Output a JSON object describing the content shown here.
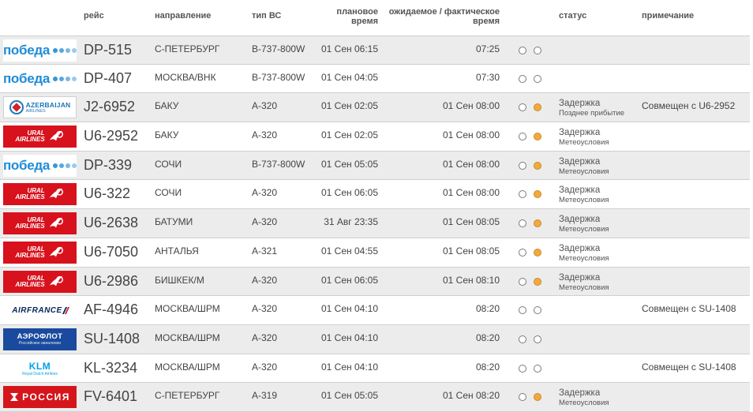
{
  "header": {
    "flight": "рейс",
    "direction": "направление",
    "aircraft_type": "тип ВС",
    "planned_time": "плановое время",
    "expected_time": "ожидаемое / фактическое время",
    "status": "статус",
    "note": "примечание"
  },
  "colors": {
    "indicator_active": "#f3a93c",
    "row_alt": "#ececec",
    "pobeda_blue": "#1f8bd6",
    "ural_red": "#d7121d"
  },
  "logo_text": {
    "pobeda": "победа",
    "ural_1": "URAL",
    "ural_2": "AIRLINES",
    "azal_1": "AZERBAIJAN",
    "azal_2": "AIRLINES",
    "airfrance": "AIRFRANCE",
    "aeroflot_1": "АЭРОФЛОТ",
    "aeroflot_2": "Российские авиалинии",
    "klm_1": "KLM",
    "klm_2": "Royal Dutch Airlines",
    "rossiya": "РОССИЯ"
  },
  "rows": [
    {
      "airline": "pobeda",
      "flight": "DP-515",
      "direction": "С-ПЕТЕРБУРГ",
      "aircraft": "B-737-800W",
      "planned": "01 Сен 06:15",
      "expected": "07:25",
      "ind1": false,
      "ind2": false,
      "status": "",
      "status_sub": "",
      "note": ""
    },
    {
      "airline": "pobeda",
      "flight": "DP-407",
      "direction": "МОСКВА/ВНК",
      "aircraft": "B-737-800W",
      "planned": "01 Сен 04:05",
      "expected": "07:30",
      "ind1": false,
      "ind2": false,
      "status": "",
      "status_sub": "",
      "note": ""
    },
    {
      "airline": "azal",
      "flight": "J2-6952",
      "direction": "БАКУ",
      "aircraft": "A-320",
      "planned": "01 Сен 02:05",
      "expected": "01 Сен 08:00",
      "ind1": false,
      "ind2": true,
      "status": "Задержка",
      "status_sub": "Позднее прибытие",
      "note": "Совмещен с U6-2952"
    },
    {
      "airline": "ural",
      "flight": "U6-2952",
      "direction": "БАКУ",
      "aircraft": "A-320",
      "planned": "01 Сен 02:05",
      "expected": "01 Сен 08:00",
      "ind1": false,
      "ind2": true,
      "status": "Задержка",
      "status_sub": "Метеоусловия",
      "note": ""
    },
    {
      "airline": "pobeda",
      "flight": "DP-339",
      "direction": "СОЧИ",
      "aircraft": "B-737-800W",
      "planned": "01 Сен 05:05",
      "expected": "01 Сен 08:00",
      "ind1": false,
      "ind2": true,
      "status": "Задержка",
      "status_sub": "Метеоусловия",
      "note": ""
    },
    {
      "airline": "ural",
      "flight": "U6-322",
      "direction": "СОЧИ",
      "aircraft": "A-320",
      "planned": "01 Сен 06:05",
      "expected": "01 Сен 08:00",
      "ind1": false,
      "ind2": true,
      "status": "Задержка",
      "status_sub": "Метеоусловия",
      "note": ""
    },
    {
      "airline": "ural",
      "flight": "U6-2638",
      "direction": "БАТУМИ",
      "aircraft": "A-320",
      "planned": "31 Авг 23:35",
      "expected": "01 Сен 08:05",
      "ind1": false,
      "ind2": true,
      "status": "Задержка",
      "status_sub": "Метеоусловия",
      "note": ""
    },
    {
      "airline": "ural",
      "flight": "U6-7050",
      "direction": "АНТАЛЬЯ",
      "aircraft": "A-321",
      "planned": "01 Сен 04:55",
      "expected": "01 Сен 08:05",
      "ind1": false,
      "ind2": true,
      "status": "Задержка",
      "status_sub": "Метеоусловия",
      "note": ""
    },
    {
      "airline": "ural",
      "flight": "U6-2986",
      "direction": "БИШКЕК/М",
      "aircraft": "A-320",
      "planned": "01 Сен 06:05",
      "expected": "01 Сен 08:10",
      "ind1": false,
      "ind2": true,
      "status": "Задержка",
      "status_sub": "Метеоусловия",
      "note": ""
    },
    {
      "airline": "airfrance",
      "flight": "AF-4946",
      "direction": "МОСКВА/ШРМ",
      "aircraft": "A-320",
      "planned": "01 Сен 04:10",
      "expected": "08:20",
      "ind1": false,
      "ind2": false,
      "status": "",
      "status_sub": "",
      "note": "Совмещен с SU-1408"
    },
    {
      "airline": "aeroflot",
      "flight": "SU-1408",
      "direction": "МОСКВА/ШРМ",
      "aircraft": "A-320",
      "planned": "01 Сен 04:10",
      "expected": "08:20",
      "ind1": false,
      "ind2": false,
      "status": "",
      "status_sub": "",
      "note": ""
    },
    {
      "airline": "klm",
      "flight": "KL-3234",
      "direction": "МОСКВА/ШРМ",
      "aircraft": "A-320",
      "planned": "01 Сен 04:10",
      "expected": "08:20",
      "ind1": false,
      "ind2": false,
      "status": "",
      "status_sub": "",
      "note": "Совмещен с SU-1408"
    },
    {
      "airline": "rossiya",
      "flight": "FV-6401",
      "direction": "С-ПЕТЕРБУРГ",
      "aircraft": "A-319",
      "planned": "01 Сен 05:05",
      "expected": "01 Сен 08:20",
      "ind1": false,
      "ind2": true,
      "status": "Задержка",
      "status_sub": "Метеоусловия",
      "note": ""
    }
  ]
}
